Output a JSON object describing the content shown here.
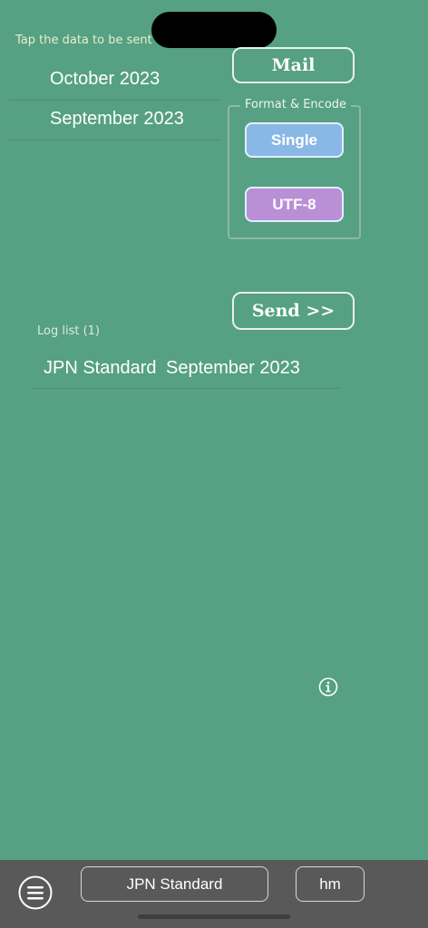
{
  "header": {
    "hint": "Tap the data to be sent"
  },
  "data_list": [
    {
      "label": "October 2023"
    },
    {
      "label": "September 2023"
    }
  ],
  "actions": {
    "mail_label": "Mail",
    "send_label": "Send >>"
  },
  "format_group": {
    "title": "Format & Encode",
    "format_label": "Single",
    "encoding_label": "UTF-8",
    "format_color": "#8ab8e6",
    "encoding_color": "#b98fd6"
  },
  "log": {
    "label": "Log list (1)",
    "entries": [
      {
        "format": "JPN Standard",
        "date": "September 2023"
      }
    ]
  },
  "bottom_bar": {
    "mode_label": "JPN Standard",
    "unit_label": "hm"
  },
  "icons": {
    "info": "info-icon",
    "menu": "hamburger-menu-icon"
  }
}
